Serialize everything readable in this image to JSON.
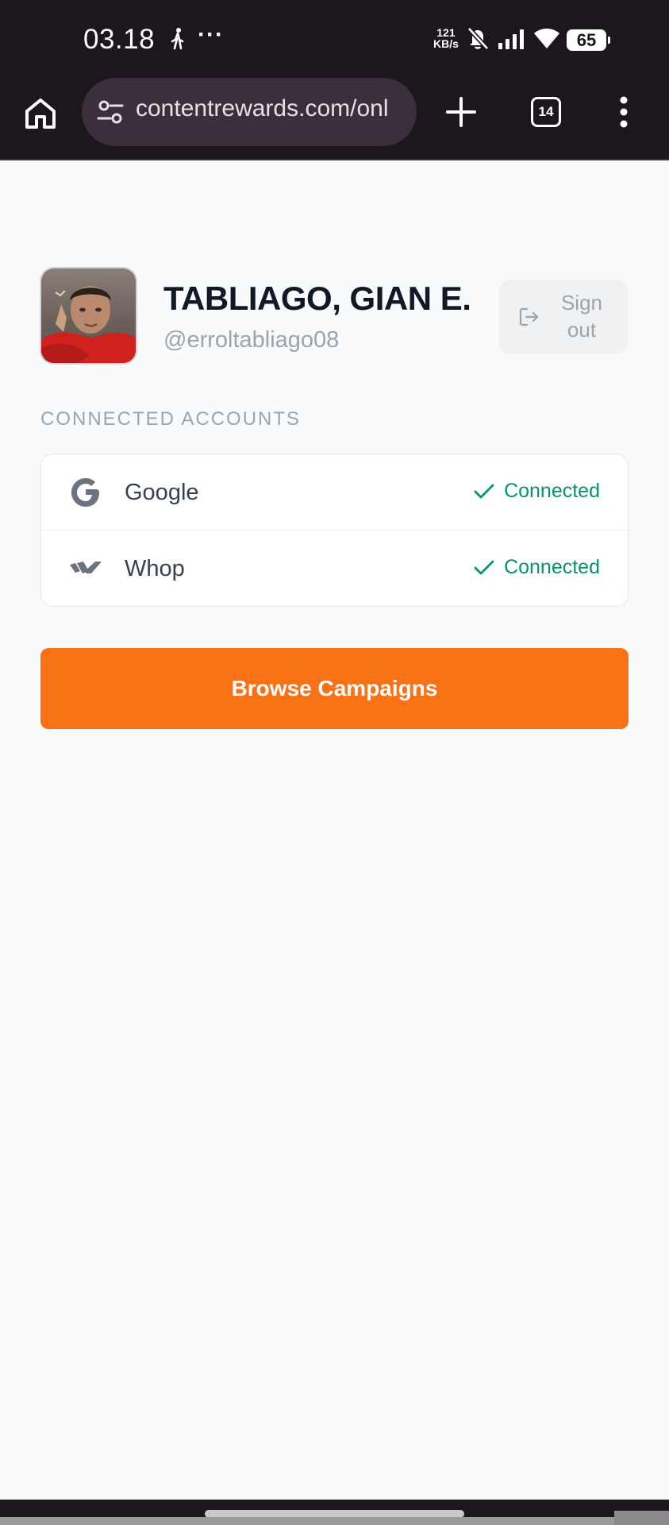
{
  "status_bar": {
    "time": "03.18",
    "more": "···",
    "net_speed_value": "121",
    "net_speed_unit": "KB/s",
    "battery": "65"
  },
  "browser": {
    "url": "contentrewards.com/onl",
    "tab_count": "14"
  },
  "profile": {
    "name": "TABLIAGO, GIAN E...",
    "handle": "@erroltabliago08",
    "sign_out_label": "Sign out"
  },
  "connected_accounts": {
    "section_title": "CONNECTED ACCOUNTS",
    "items": [
      {
        "name": "Google",
        "status": "Connected",
        "icon": "google-icon"
      },
      {
        "name": "Whop",
        "status": "Connected",
        "icon": "whop-icon"
      }
    ]
  },
  "cta": {
    "browse_label": "Browse Campaigns"
  },
  "colors": {
    "accent": "#f97316",
    "connected": "#059669",
    "muted": "#9ca3af",
    "chrome": "#1c171c"
  }
}
